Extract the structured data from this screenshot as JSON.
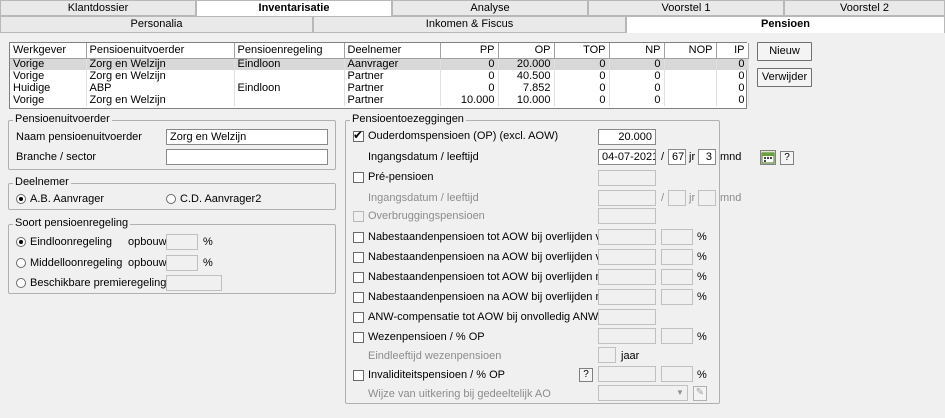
{
  "top_tabs": [
    "Klantdossier",
    "Inventarisatie",
    "Analyse",
    "Voorstel 1",
    "Voorstel 2"
  ],
  "sub_tabs": [
    "Personalia",
    "Inkomen & Fiscus",
    "Pensioen"
  ],
  "table": {
    "headers": [
      "Werkgever",
      "Pensioenuitvoerder",
      "Pensioenregeling",
      "Deelnemer",
      "PP",
      "OP",
      "TOP",
      "NP",
      "NOP",
      "IP"
    ],
    "rows": [
      [
        "Vorige",
        "Zorg en Welzijn",
        "Eindloon",
        "Aanvrager",
        "0",
        "20.000",
        "0",
        "0",
        "",
        "0"
      ],
      [
        "Vorige",
        "Zorg en Welzijn",
        "",
        "Partner",
        "0",
        "40.500",
        "0",
        "0",
        "",
        "0"
      ],
      [
        "Huidige",
        "ABP",
        "Eindloon",
        "Partner",
        "0",
        "7.852",
        "0",
        "0",
        "",
        "0"
      ],
      [
        "Vorige",
        "Zorg en Welzijn",
        "",
        "Partner",
        "10.000",
        "10.000",
        "0",
        "0",
        "",
        "0"
      ]
    ]
  },
  "buttons": {
    "nieuw": "Nieuw",
    "verwijder": "Verwijder"
  },
  "uitvoerder": {
    "title": "Pensioenuitvoerder",
    "naam_label": "Naam pensioenuitvoerder",
    "naam_value": "Zorg en Welzijn",
    "branche_label": "Branche / sector",
    "branche_value": ""
  },
  "deelnemer": {
    "title": "Deelnemer",
    "option1": "A.B. Aanvrager",
    "option2": "C.D. Aanvrager2"
  },
  "soort": {
    "title": "Soort pensioenregeling",
    "eindloon": "Eindloonregeling",
    "middelloon": "Middelloonregeling",
    "beschikbare": "Beschikbare premieregeling",
    "opbouw": "opbouw",
    "pct": "%"
  },
  "toezeggingen": {
    "title": "Pensioentoezeggingen",
    "op_label": "Ouderdomspensioen (OP) (excl. AOW)",
    "op_value": "20.000",
    "ingang_label": "Ingangsdatum / leeftijd",
    "ingang_date": "04-07-2021",
    "slash": "/",
    "ingang_jr": "67",
    "jr": "jr",
    "ingang_mnd": "3",
    "mnd": "mnd",
    "help": "?",
    "pre_label": "Pré-pensioen",
    "overbrugging_label": "Overbruggingspensioen",
    "nab1": "Nabestaandenpensioen tot AOW bij overlijden voor AOW",
    "nab2": "Nabestaandenpensioen na AOW bij overlijden voor AOW",
    "nab3": "Nabestaandenpensioen tot AOW bij overlijden na AOW",
    "nab4": "Nabestaandenpensioen na AOW bij overlijden na AOW",
    "anw": "ANW-compensatie tot AOW bij onvolledig ANW",
    "wezen": "Wezenpensioen / % OP",
    "eindleeftijd": "Eindleeftijd wezenpensioen",
    "jaar": "jaar",
    "invaliditeit": "Invaliditeitspensioen / % OP",
    "wijze": "Wijze van uitkering bij gedeeltelijk AO",
    "pct": "%"
  }
}
